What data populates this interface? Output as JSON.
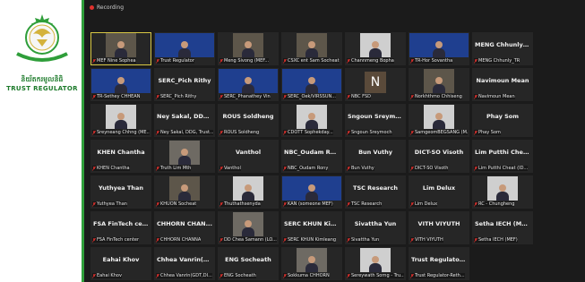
{
  "logo": {
    "kh_text": "និយ័តករមូលនិធិ",
    "en_text": "TRUST REGULATOR"
  },
  "recording": {
    "label": "Recording",
    "icon": "record-icon"
  },
  "tiles": [
    {
      "label": "MEF Nine Sophea",
      "center": "",
      "video": "room",
      "mic": true,
      "active": true
    },
    {
      "label": "Trust Regulator",
      "center": "",
      "video": "blue",
      "mic": true
    },
    {
      "label": "Meng Sivong (MEF...",
      "center": "",
      "video": "room",
      "mic": true
    },
    {
      "label": "CSXC ent Sam Socheat",
      "center": "",
      "video": "room",
      "mic": true
    },
    {
      "label": "Channmeng Bopha",
      "center": "",
      "video": "light",
      "mic": true
    },
    {
      "label": "TR-Hor Sovantha",
      "center": "",
      "video": "blue",
      "mic": true
    },
    {
      "label": "MENG Chhunly_TR",
      "center": "MENG Chhunly_...",
      "video": "",
      "mic": true
    },
    {
      "label": "TR-Sethey CHHEAN",
      "center": "",
      "video": "blue",
      "mic": true
    },
    {
      "label": "SERC_Pich Rithy",
      "center": "SERC_Pich Rithy",
      "video": "",
      "mic": true
    },
    {
      "label": "SERC_Phanathey Vin",
      "center": "",
      "video": "blue",
      "mic": true
    },
    {
      "label": "SERC_Oek/VIRSSUN...",
      "center": "",
      "video": "blue",
      "mic": true
    },
    {
      "label": "NBC FSD",
      "center": "",
      "video": "avatar-n",
      "mic": true
    },
    {
      "label": "Norkhthmo Chhiseng",
      "center": "",
      "video": "room",
      "mic": true
    },
    {
      "label": "Navimoun Mean",
      "center": "Navimoun Mean",
      "video": "",
      "mic": true
    },
    {
      "label": "Sreyneang Chhng (ME...",
      "center": "",
      "video": "light",
      "mic": true
    },
    {
      "label": "Ney Sakal, DDG, Trust...",
      "center": "Ney Sakal, DDG,...",
      "video": "",
      "mic": true
    },
    {
      "label": "ROUS Soldheng",
      "center": "ROUS Soldheng",
      "video": "",
      "mic": true
    },
    {
      "label": "CDOTT Sophekday...",
      "center": "",
      "video": "light",
      "mic": true
    },
    {
      "label": "Sngoun Sreymoch",
      "center": "Sngoun Sreymoch",
      "video": "",
      "mic": true
    },
    {
      "label": "SamgeomBEGSANG (M...",
      "center": "",
      "video": "light",
      "mic": true
    },
    {
      "label": "Phay Som",
      "center": "Phay Som",
      "video": "",
      "mic": true
    },
    {
      "label": "KHEN Chantha",
      "center": "KHEN Chantha",
      "video": "",
      "mic": true
    },
    {
      "label": "Truth Lim Mth",
      "center": "",
      "video": "office",
      "mic": true
    },
    {
      "label": "Vanthol",
      "center": "Vanthol",
      "video": "",
      "mic": true
    },
    {
      "label": "NBC_Oudam Rony",
      "center": "NBC_Oudam Rony",
      "video": "",
      "mic": true
    },
    {
      "label": "Bun Vuthy",
      "center": "Bun Vuthy",
      "video": "",
      "mic": true
    },
    {
      "label": "DICT-SO Visoth",
      "center": "DICT-SO Visoth",
      "video": "",
      "mic": true
    },
    {
      "label": "Lim Putthi Cheat (ID...",
      "center": "Lim Putthi Chea...",
      "video": "",
      "mic": true
    },
    {
      "label": "Yuthyea Than",
      "center": "Yuthyea Than",
      "video": "",
      "mic": true
    },
    {
      "label": "KHUON Socheat",
      "center": "",
      "video": "room",
      "mic": true
    },
    {
      "label": "Thuthathsenyda",
      "center": "",
      "video": "light",
      "mic": true
    },
    {
      "label": "KAN (someone MEF)",
      "center": "",
      "video": "blue",
      "mic": true
    },
    {
      "label": "TSC Research",
      "center": "TSC Research",
      "video": "",
      "mic": true
    },
    {
      "label": "Lim Delux",
      "center": "Lim Delux",
      "video": "",
      "mic": true
    },
    {
      "label": "RC - Chungheng",
      "center": "",
      "video": "light",
      "mic": true
    },
    {
      "label": "FSA FinTech center",
      "center": "FSA FinTech cen...",
      "video": "",
      "mic": true
    },
    {
      "label": "CHHORN CHANNA",
      "center": "CHHORN CHAN...",
      "video": "",
      "mic": true
    },
    {
      "label": "DD Chea Samann (LO...",
      "center": "",
      "video": "office",
      "mic": true
    },
    {
      "label": "SERC KHUN Kimleang",
      "center": "SERC KHUN Kim...",
      "video": "",
      "mic": true
    },
    {
      "label": "Sivattha Yun",
      "center": "Sivattha Yun",
      "video": "",
      "mic": true
    },
    {
      "label": "VITH VIYUTH",
      "center": "VITH VIYUTH",
      "video": "",
      "mic": true
    },
    {
      "label": "Setha IECH (MEF)",
      "center": "Setha IECH (MEF)",
      "video": "",
      "mic": true
    },
    {
      "label": "Eahai Khov",
      "center": "Eahai Khov",
      "video": "",
      "mic": true
    },
    {
      "label": "Chhea Vanrin(GDT,DI...",
      "center": "Chhea Vanrin(G...",
      "video": "",
      "mic": true
    },
    {
      "label": "ENG Socheath",
      "center": "ENG Socheath",
      "video": "",
      "mic": true
    },
    {
      "label": "Sokkuma CHHORN",
      "center": "",
      "video": "office",
      "mic": true
    },
    {
      "label": "Sereywath Sorng - Tru...",
      "center": "",
      "video": "light",
      "mic": true
    },
    {
      "label": "Trust Regulator-Reth...",
      "center": "Trust Regulator-...",
      "video": "",
      "mic": true
    }
  ]
}
